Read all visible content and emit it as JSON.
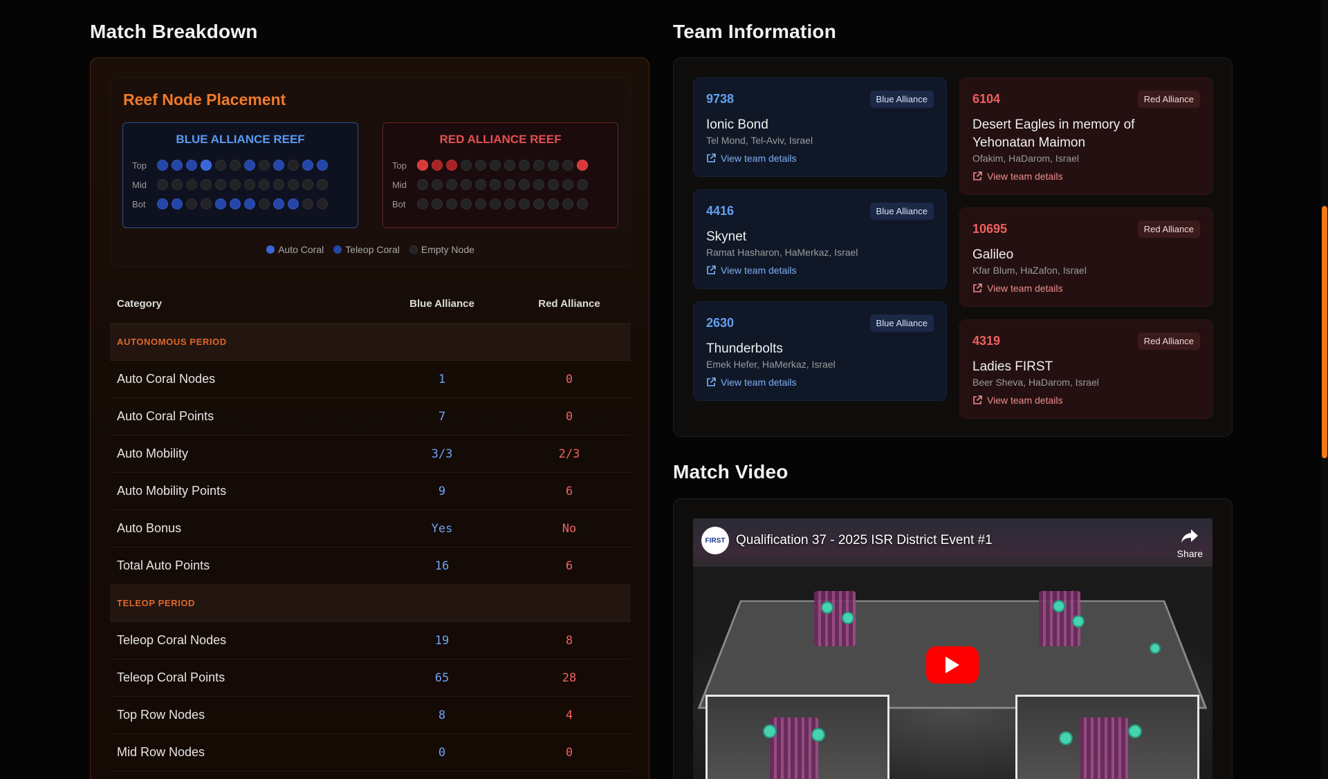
{
  "match_breakdown": {
    "title": "Match Breakdown",
    "reef": {
      "title": "Reef Node Placement",
      "blue": {
        "heading": "BLUE ALLIANCE REEF",
        "rows": [
          {
            "label": "Top",
            "nodes": [
              "t",
              "t",
              "t",
              "a",
              "e",
              "e",
              "t",
              "e",
              "t",
              "e",
              "t",
              "t"
            ]
          },
          {
            "label": "Mid",
            "nodes": [
              "e",
              "e",
              "e",
              "e",
              "e",
              "e",
              "e",
              "e",
              "e",
              "e",
              "e",
              "e"
            ]
          },
          {
            "label": "Bot",
            "nodes": [
              "t",
              "t",
              "e",
              "e",
              "t",
              "t",
              "t",
              "e",
              "t",
              "t",
              "e",
              "e"
            ]
          }
        ]
      },
      "red": {
        "heading": "RED ALLIANCE REEF",
        "rows": [
          {
            "label": "Top",
            "nodes": [
              "a",
              "t",
              "t",
              "e",
              "e",
              "e",
              "e",
              "e",
              "e",
              "e",
              "e",
              "a"
            ]
          },
          {
            "label": "Mid",
            "nodes": [
              "e",
              "e",
              "e",
              "e",
              "e",
              "e",
              "e",
              "e",
              "e",
              "e",
              "e",
              "e"
            ]
          },
          {
            "label": "Bot",
            "nodes": [
              "e",
              "e",
              "e",
              "e",
              "e",
              "e",
              "e",
              "e",
              "e",
              "e",
              "e",
              "e"
            ]
          }
        ]
      },
      "legend": [
        {
          "label": "Auto Coral",
          "color": "#3a65d8"
        },
        {
          "label": "Teleop Coral",
          "color": "#2446a8"
        },
        {
          "label": "Empty Node",
          "color": "#232326"
        }
      ]
    },
    "table": {
      "headers": [
        "Category",
        "Blue Alliance",
        "Red Alliance"
      ],
      "sections": [
        {
          "period": "AUTONOMOUS PERIOD",
          "rows": [
            {
              "category": "Auto Coral Nodes",
              "blue": "1",
              "red": "0"
            },
            {
              "category": "Auto Coral Points",
              "blue": "7",
              "red": "0"
            },
            {
              "category": "Auto Mobility",
              "blue": "3/3",
              "red": "2/3"
            },
            {
              "category": "Auto Mobility Points",
              "blue": "9",
              "red": "6"
            },
            {
              "category": "Auto Bonus",
              "blue": "Yes",
              "red": "No"
            },
            {
              "category": "Total Auto Points",
              "blue": "16",
              "red": "6"
            }
          ]
        },
        {
          "period": "TELEOP PERIOD",
          "rows": [
            {
              "category": "Teleop Coral Nodes",
              "blue": "19",
              "red": "8"
            },
            {
              "category": "Teleop Coral Points",
              "blue": "65",
              "red": "28"
            },
            {
              "category": "Top Row Nodes",
              "blue": "8",
              "red": "4"
            },
            {
              "category": "Mid Row Nodes",
              "blue": "0",
              "red": "0"
            }
          ]
        }
      ]
    }
  },
  "team_information": {
    "title": "Team Information",
    "link_label": "View team details",
    "blue": [
      {
        "number": "9738",
        "badge": "Blue Alliance",
        "name": "Ionic Bond",
        "location": "Tel Mond, Tel-Aviv, Israel"
      },
      {
        "number": "4416",
        "badge": "Blue Alliance",
        "name": "Skynet",
        "location": "Ramat Hasharon, HaMerkaz, Israel"
      },
      {
        "number": "2630",
        "badge": "Blue Alliance",
        "name": "Thunderbolts",
        "location": "Emek Hefer, HaMerkaz, Israel"
      }
    ],
    "red": [
      {
        "number": "6104",
        "badge": "Red Alliance",
        "name": "Desert Eagles in memory of Yehonatan Maimon",
        "location": "Ofakim, HaDarom, Israel"
      },
      {
        "number": "10695",
        "badge": "Red Alliance",
        "name": "Galileo",
        "location": "Kfar Blum, HaZafon, Israel"
      },
      {
        "number": "4319",
        "badge": "Red Alliance",
        "name": "Ladies FIRST",
        "location": "Beer Sheva, HaDarom, Israel"
      }
    ]
  },
  "match_video": {
    "title": "Match Video",
    "video_title": "Qualification 37 - 2025 ISR District Event #1",
    "logo_text": "FIRST",
    "share_label": "Share"
  },
  "colors": {
    "accent": "#f07a2a",
    "blue": "#62a0f0",
    "red": "#ee6060"
  }
}
